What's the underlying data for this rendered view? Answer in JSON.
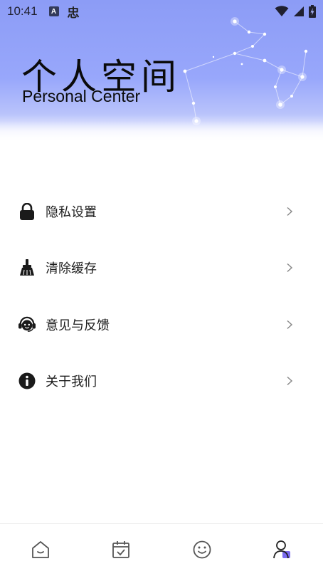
{
  "status_bar": {
    "time": "10:41",
    "left_icons": [
      "a-badge-icon",
      "hanzi-notification-icon"
    ],
    "a_badge_text": "A",
    "hanzi_text": "忠",
    "right_icons": [
      "wifi-icon",
      "signal-icon",
      "battery-charging-icon"
    ]
  },
  "header": {
    "title": "个人空间",
    "subtitle": "Personal Center"
  },
  "menu": {
    "items": [
      {
        "label": "隐私设置",
        "icon": "lock-icon"
      },
      {
        "label": "清除缓存",
        "icon": "broom-icon"
      },
      {
        "label": "意见与反馈",
        "icon": "headset-icon"
      },
      {
        "label": "关于我们",
        "icon": "info-icon"
      }
    ]
  },
  "bottom_nav": {
    "items": [
      {
        "icon": "home-icon",
        "active": false
      },
      {
        "icon": "calendar-check-icon",
        "active": false
      },
      {
        "icon": "smiley-icon",
        "active": false
      },
      {
        "icon": "user-icon",
        "active": true
      }
    ]
  },
  "colors": {
    "header_gradient_top": "#8c9cf6",
    "header_gradient_bottom": "#ffffff",
    "accent": "#7b6cf0",
    "icon": "#1a1a1a",
    "chevron": "#8a8a8a"
  }
}
